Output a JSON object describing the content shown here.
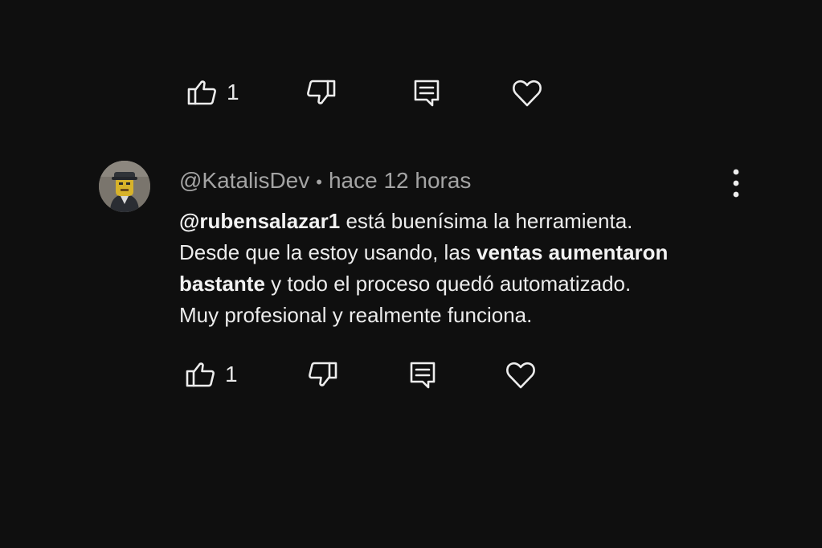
{
  "top_actions": {
    "like_count": "1",
    "icons": [
      "thumbs-up-icon",
      "thumbs-down-icon",
      "reply-icon",
      "heart-icon"
    ]
  },
  "comment": {
    "author": "@KatalisDev",
    "separator": "•",
    "time": "hace 12 horas",
    "mention": "@rubensalazar1",
    "line1_rest": " está buenísima la herramienta.",
    "line2_start": "Desde que la estoy usando, las ",
    "line2_bold": "ventas aumentaron",
    "line3_bold": "bastante",
    "line3_rest": " y todo el proceso quedó automatizado.",
    "line4": "Muy profesional y realmente funciona.",
    "like_count": "1",
    "more_icon": "more-vert-icon"
  },
  "colors": {
    "background": "#0f0f0f",
    "text": "#ececec",
    "meta": "#a4a4a4"
  }
}
